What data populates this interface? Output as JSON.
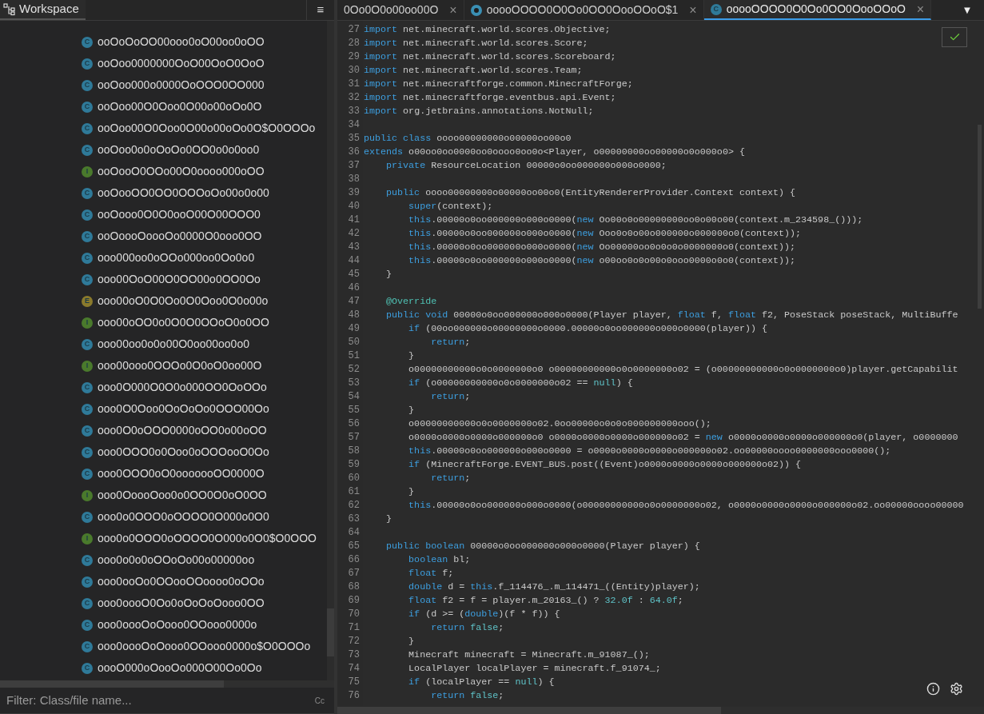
{
  "workspace": {
    "title": "Workspace",
    "menu_button": "≡",
    "items": [
      {
        "kind": "class",
        "badge": "C",
        "name": "ooOoOoOO00ooo0oO00oo0oOO"
      },
      {
        "kind": "class",
        "badge": "C",
        "name": "ooOoo0000000OoO00OoO0OoO"
      },
      {
        "kind": "class",
        "badge": "C",
        "name": "ooOoo000o0000OoOOO0OO000"
      },
      {
        "kind": "class",
        "badge": "C",
        "name": "ooOoo00O0Ooo0O00o00oOo0O"
      },
      {
        "kind": "class",
        "badge": "C",
        "name": "ooOoo00O0Ooo0O00o00oOo0O$O0OOOo"
      },
      {
        "kind": "class",
        "badge": "C",
        "name": "ooOoo0o0oOoOo0OO0o0o0oo0"
      },
      {
        "kind": "interface",
        "badge": "I",
        "name": "ooOooO0OOo00O0oooo000oOO"
      },
      {
        "kind": "class",
        "badge": "C",
        "name": "ooOooOO0OO0OOOoOo00o0o00"
      },
      {
        "kind": "class",
        "badge": "C",
        "name": "ooOooo0O0O0ooO00O00OOO0"
      },
      {
        "kind": "class",
        "badge": "C",
        "name": "ooOoooOoooOo0000O0ooo0OO"
      },
      {
        "kind": "class",
        "badge": "C",
        "name": "ooo000oo0oOOo000oo0Oo0o0"
      },
      {
        "kind": "class",
        "badge": "C",
        "name": "ooo00OoO00O0OO00o0OO0Oo"
      },
      {
        "kind": "enum",
        "badge": "E",
        "name": "ooo00oO0O0Oo0O0Ooo0O0o00o"
      },
      {
        "kind": "interface",
        "badge": "I",
        "name": "ooo00oOO0o0O0O0OOoO0o0OO"
      },
      {
        "kind": "class",
        "badge": "C",
        "name": "ooo00oo0o0o00O0oo00oo0o0"
      },
      {
        "kind": "interface",
        "badge": "I",
        "name": "ooo00ooo0OOOo0O0oO0oo00O"
      },
      {
        "kind": "class",
        "badge": "C",
        "name": "ooo0O000O0O0o000OO0OoOOo"
      },
      {
        "kind": "class",
        "badge": "C",
        "name": "ooo0O0Ooo0OoOoOo0OOO00Oo"
      },
      {
        "kind": "class",
        "badge": "C",
        "name": "ooo0O0oOOO0000oOO0o00oOO"
      },
      {
        "kind": "class",
        "badge": "C",
        "name": "ooo0OOO0o0Ooo0oOOOooO0Oo"
      },
      {
        "kind": "class",
        "badge": "C",
        "name": "ooo0OOO0oO0ooooooOO0000O"
      },
      {
        "kind": "interface",
        "badge": "I",
        "name": "ooo0OoooOoo0o0OO0O0oO0OO"
      },
      {
        "kind": "class",
        "badge": "C",
        "name": "ooo0o0OOO0oOOOO0O000o0O0"
      },
      {
        "kind": "interface",
        "badge": "I",
        "name": "ooo0o0OOO0oOOOO0O000o0O0$O0OOO"
      },
      {
        "kind": "class",
        "badge": "C",
        "name": "ooo0o0o0oOOoOo00o00000oo"
      },
      {
        "kind": "class",
        "badge": "C",
        "name": "ooo0ooOo0OOooOOoooo0oOOo"
      },
      {
        "kind": "class",
        "badge": "C",
        "name": "ooo0oooO0Oo0oOoOoOooo0OO"
      },
      {
        "kind": "class",
        "badge": "C",
        "name": "ooo0oooOoOooo0OOooo0000o"
      },
      {
        "kind": "class",
        "badge": "C",
        "name": "ooo0oooOoOooo0OOooo0000o$O0OOOo"
      },
      {
        "kind": "class",
        "badge": "C",
        "name": "oooO000oOooOo000O00Oo0Oo"
      }
    ],
    "filter": {
      "placeholder": "Filter: Class/file name...",
      "case_button": "Cc"
    }
  },
  "tabs": [
    {
      "kind": "plain",
      "label": "0Oo0O0o00oo00O",
      "selected": false,
      "close": "×"
    },
    {
      "kind": "inner",
      "label": "ooooOOOO0O0Oo0OO0OooOOoO$1",
      "selected": false,
      "close": "×"
    },
    {
      "kind": "class",
      "badge": "C",
      "label": "ooooOOOO0O0Oo0OO0OooOOoO",
      "selected": true,
      "close": "×"
    }
  ],
  "tab_menu": "▼",
  "editor": {
    "lines": [
      {
        "n": "27",
        "tokens": [
          {
            "kind": "kw",
            "text": "import"
          },
          {
            "kind": "p",
            "text": " net.minecraft.world.scores.Objective;"
          }
        ]
      },
      {
        "n": "28",
        "tokens": [
          {
            "kind": "kw",
            "text": "import"
          },
          {
            "kind": "p",
            "text": " net.minecraft.world.scores.Score;"
          }
        ]
      },
      {
        "n": "29",
        "tokens": [
          {
            "kind": "kw",
            "text": "import"
          },
          {
            "kind": "p",
            "text": " net.minecraft.world.scores.Scoreboard;"
          }
        ]
      },
      {
        "n": "30",
        "tokens": [
          {
            "kind": "kw",
            "text": "import"
          },
          {
            "kind": "p",
            "text": " net.minecraft.world.scores.Team;"
          }
        ]
      },
      {
        "n": "31",
        "tokens": [
          {
            "kind": "kw",
            "text": "import"
          },
          {
            "kind": "p",
            "text": " net.minecraftforge.common.MinecraftForge;"
          }
        ]
      },
      {
        "n": "32",
        "tokens": [
          {
            "kind": "kw",
            "text": "import"
          },
          {
            "kind": "p",
            "text": " net.minecraftforge.eventbus.api.Event;"
          }
        ]
      },
      {
        "n": "33",
        "tokens": [
          {
            "kind": "kw",
            "text": "import"
          },
          {
            "kind": "p",
            "text": " org.jetbrains.annotations.NotNull;"
          }
        ]
      },
      {
        "n": "34"
      },
      {
        "n": "35",
        "tokens": [
          {
            "kind": "kw",
            "text": "public class"
          },
          {
            "kind": "p",
            "text": " oooo00000000o00000oo00o0"
          }
        ]
      },
      {
        "n": "36",
        "tokens": [
          {
            "kind": "kw",
            "text": "extends"
          },
          {
            "kind": "p",
            "text": " o00oo0oo0000oo0oooo0oo0o<Player, o00000000oo00000o0o000o0> {"
          }
        ]
      },
      {
        "n": "37",
        "tokens": [
          {
            "kind": "kw",
            "text": "    private"
          },
          {
            "kind": "p",
            "text": " ResourceLocation 00000o0oo000000o000o0000;"
          }
        ]
      },
      {
        "n": "38"
      },
      {
        "n": "39",
        "tokens": [
          {
            "kind": "kw",
            "text": "    public"
          },
          {
            "kind": "p",
            "text": " oooo00000000o00000oo00o0(EntityRendererProvider.Context context) {"
          }
        ]
      },
      {
        "n": "40",
        "tokens": [
          {
            "kind": "kw",
            "text": "        super"
          },
          {
            "kind": "p",
            "text": "(context);"
          }
        ]
      },
      {
        "n": "41",
        "tokens": [
          {
            "kind": "kw",
            "text": "        this"
          },
          {
            "kind": "p",
            "text": ".00000o0oo000000o000o0000("
          },
          {
            "kind": "kw",
            "text": "new"
          },
          {
            "kind": "p",
            "text": " Oo00o0o00000000oo0o00o00(context.m_234598_()));"
          }
        ]
      },
      {
        "n": "42",
        "tokens": [
          {
            "kind": "kw",
            "text": "        this"
          },
          {
            "kind": "p",
            "text": ".00000o0oo000000o000o0000("
          },
          {
            "kind": "kw",
            "text": "new"
          },
          {
            "kind": "p",
            "text": " Ooo0o0o00o000000o000000o0(context));"
          }
        ]
      },
      {
        "n": "43",
        "tokens": [
          {
            "kind": "kw",
            "text": "        this"
          },
          {
            "kind": "p",
            "text": ".00000o0oo000000o000o0000("
          },
          {
            "kind": "kw",
            "text": "new"
          },
          {
            "kind": "p",
            "text": " Oo00000oo0o0o0o0000000o0(context));"
          }
        ]
      },
      {
        "n": "44",
        "tokens": [
          {
            "kind": "kw",
            "text": "        this"
          },
          {
            "kind": "p",
            "text": ".00000o0oo000000o000o0000("
          },
          {
            "kind": "kw",
            "text": "new"
          },
          {
            "kind": "p",
            "text": " o00oo0o0o00o0ooo0000o0o0(context));"
          }
        ]
      },
      {
        "n": "45",
        "tokens": [
          {
            "kind": "p",
            "text": "    }"
          }
        ]
      },
      {
        "n": "46"
      },
      {
        "n": "47",
        "tokens": [
          {
            "kind": "ann",
            "text": "    @Override"
          }
        ]
      },
      {
        "n": "48",
        "tokens": [
          {
            "kind": "kw",
            "text": "    public void"
          },
          {
            "kind": "p",
            "text": " 00000o0oo000000o000o0000(Player player, "
          },
          {
            "kind": "kw",
            "text": "float"
          },
          {
            "kind": "p",
            "text": " f, "
          },
          {
            "kind": "kw",
            "text": "float"
          },
          {
            "kind": "p",
            "text": " f2, PoseStack poseStack, MultiBuffe"
          }
        ]
      },
      {
        "n": "49",
        "tokens": [
          {
            "kind": "kw",
            "text": "        if"
          },
          {
            "kind": "p",
            "text": " (00oo000000o00000000o0000.00000o0oo000000o000o0000(player)) {"
          }
        ]
      },
      {
        "n": "50",
        "tokens": [
          {
            "kind": "kw",
            "text": "            return"
          },
          {
            "kind": "p",
            "text": ";"
          }
        ]
      },
      {
        "n": "51",
        "tokens": [
          {
            "kind": "p",
            "text": "        }"
          }
        ]
      },
      {
        "n": "52",
        "tokens": [
          {
            "kind": "p",
            "text": "        o00000000000o0o0000000o0 o00000000000o0o0000000o02 = (o00000000000o0o0000000o0)player.getCapabilit"
          }
        ]
      },
      {
        "n": "53",
        "tokens": [
          {
            "kind": "kw",
            "text": "        if"
          },
          {
            "kind": "p",
            "text": " (o00000000000o0o0000000o02 == "
          },
          {
            "kind": "lit",
            "text": "null"
          },
          {
            "kind": "p",
            "text": ") {"
          }
        ]
      },
      {
        "n": "54",
        "tokens": [
          {
            "kind": "kw",
            "text": "            return"
          },
          {
            "kind": "p",
            "text": ";"
          }
        ]
      },
      {
        "n": "55",
        "tokens": [
          {
            "kind": "p",
            "text": "        }"
          }
        ]
      },
      {
        "n": "56",
        "tokens": [
          {
            "kind": "p",
            "text": "        o00000000000o0o0000000o02.0oo00000o0o0o000000000ooo();"
          }
        ]
      },
      {
        "n": "57",
        "tokens": [
          {
            "kind": "p",
            "text": "        o0000o0000o0000o000000o0 o0000o0000o0000o000000o02 = "
          },
          {
            "kind": "kw",
            "text": "new"
          },
          {
            "kind": "p",
            "text": " o0000o0000o0000o000000o0(player, o0000000"
          }
        ]
      },
      {
        "n": "58",
        "tokens": [
          {
            "kind": "kw",
            "text": "        this"
          },
          {
            "kind": "p",
            "text": ".00000o0oo000000o000o0000 = o0000o0000o0000o000000o02.oo00000oooo0000000ooo0000();"
          }
        ]
      },
      {
        "n": "59",
        "tokens": [
          {
            "kind": "kw",
            "text": "        if"
          },
          {
            "kind": "p",
            "text": " (MinecraftForge.EVENT_BUS.post((Event)o0000o0000o0000o000000o02)) {"
          }
        ]
      },
      {
        "n": "60",
        "tokens": [
          {
            "kind": "kw",
            "text": "            return"
          },
          {
            "kind": "p",
            "text": ";"
          }
        ]
      },
      {
        "n": "61",
        "tokens": [
          {
            "kind": "p",
            "text": "        }"
          }
        ]
      },
      {
        "n": "62",
        "tokens": [
          {
            "kind": "kw",
            "text": "        this"
          },
          {
            "kind": "p",
            "text": ".00000o0oo000000o000o0000(o00000000000o0o0000000o02, o0000o0000o0000o000000o02.oo00000oooo00000"
          }
        ]
      },
      {
        "n": "63",
        "tokens": [
          {
            "kind": "p",
            "text": "    }"
          }
        ]
      },
      {
        "n": "64"
      },
      {
        "n": "65",
        "tokens": [
          {
            "kind": "kw",
            "text": "    public boolean"
          },
          {
            "kind": "p",
            "text": " 00000o0oo000000o000o0000(Player player) {"
          }
        ]
      },
      {
        "n": "66",
        "tokens": [
          {
            "kind": "kw",
            "text": "        boolean"
          },
          {
            "kind": "p",
            "text": " bl;"
          }
        ]
      },
      {
        "n": "67",
        "tokens": [
          {
            "kind": "kw",
            "text": "        float"
          },
          {
            "kind": "p",
            "text": " f;"
          }
        ]
      },
      {
        "n": "68",
        "tokens": [
          {
            "kind": "kw",
            "text": "        double"
          },
          {
            "kind": "p",
            "text": " d = "
          },
          {
            "kind": "kw",
            "text": "this"
          },
          {
            "kind": "p",
            "text": ".f_114476_.m_114471_((Entity)player);"
          }
        ]
      },
      {
        "n": "69",
        "tokens": [
          {
            "kind": "kw",
            "text": "        float"
          },
          {
            "kind": "p",
            "text": " f2 = f = player.m_20163_() ? "
          },
          {
            "kind": "lit",
            "text": "32.0f"
          },
          {
            "kind": "p",
            "text": " : "
          },
          {
            "kind": "lit",
            "text": "64.0f"
          },
          {
            "kind": "p",
            "text": ";"
          }
        ]
      },
      {
        "n": "70",
        "tokens": [
          {
            "kind": "kw",
            "text": "        if"
          },
          {
            "kind": "p",
            "text": " (d >= ("
          },
          {
            "kind": "kw",
            "text": "double"
          },
          {
            "kind": "p",
            "text": ")(f * f)) {"
          }
        ]
      },
      {
        "n": "71",
        "tokens": [
          {
            "kind": "kw",
            "text": "            return"
          },
          {
            "kind": "lit",
            "text": " false"
          },
          {
            "kind": "p",
            "text": ";"
          }
        ]
      },
      {
        "n": "72",
        "tokens": [
          {
            "kind": "p",
            "text": "        }"
          }
        ]
      },
      {
        "n": "73",
        "tokens": [
          {
            "kind": "p",
            "text": "        Minecraft minecraft = Minecraft.m_91087_();"
          }
        ]
      },
      {
        "n": "74",
        "tokens": [
          {
            "kind": "p",
            "text": "        LocalPlayer localPlayer = minecraft.f_91074_;"
          }
        ]
      },
      {
        "n": "75",
        "tokens": [
          {
            "kind": "kw",
            "text": "        if"
          },
          {
            "kind": "p",
            "text": " (localPlayer == "
          },
          {
            "kind": "lit",
            "text": "null"
          },
          {
            "kind": "p",
            "text": ") {"
          }
        ]
      },
      {
        "n": "76",
        "tokens": [
          {
            "kind": "kw",
            "text": "            return"
          },
          {
            "kind": "lit",
            "text": " false"
          },
          {
            "kind": "p",
            "text": ";"
          }
        ]
      }
    ]
  }
}
